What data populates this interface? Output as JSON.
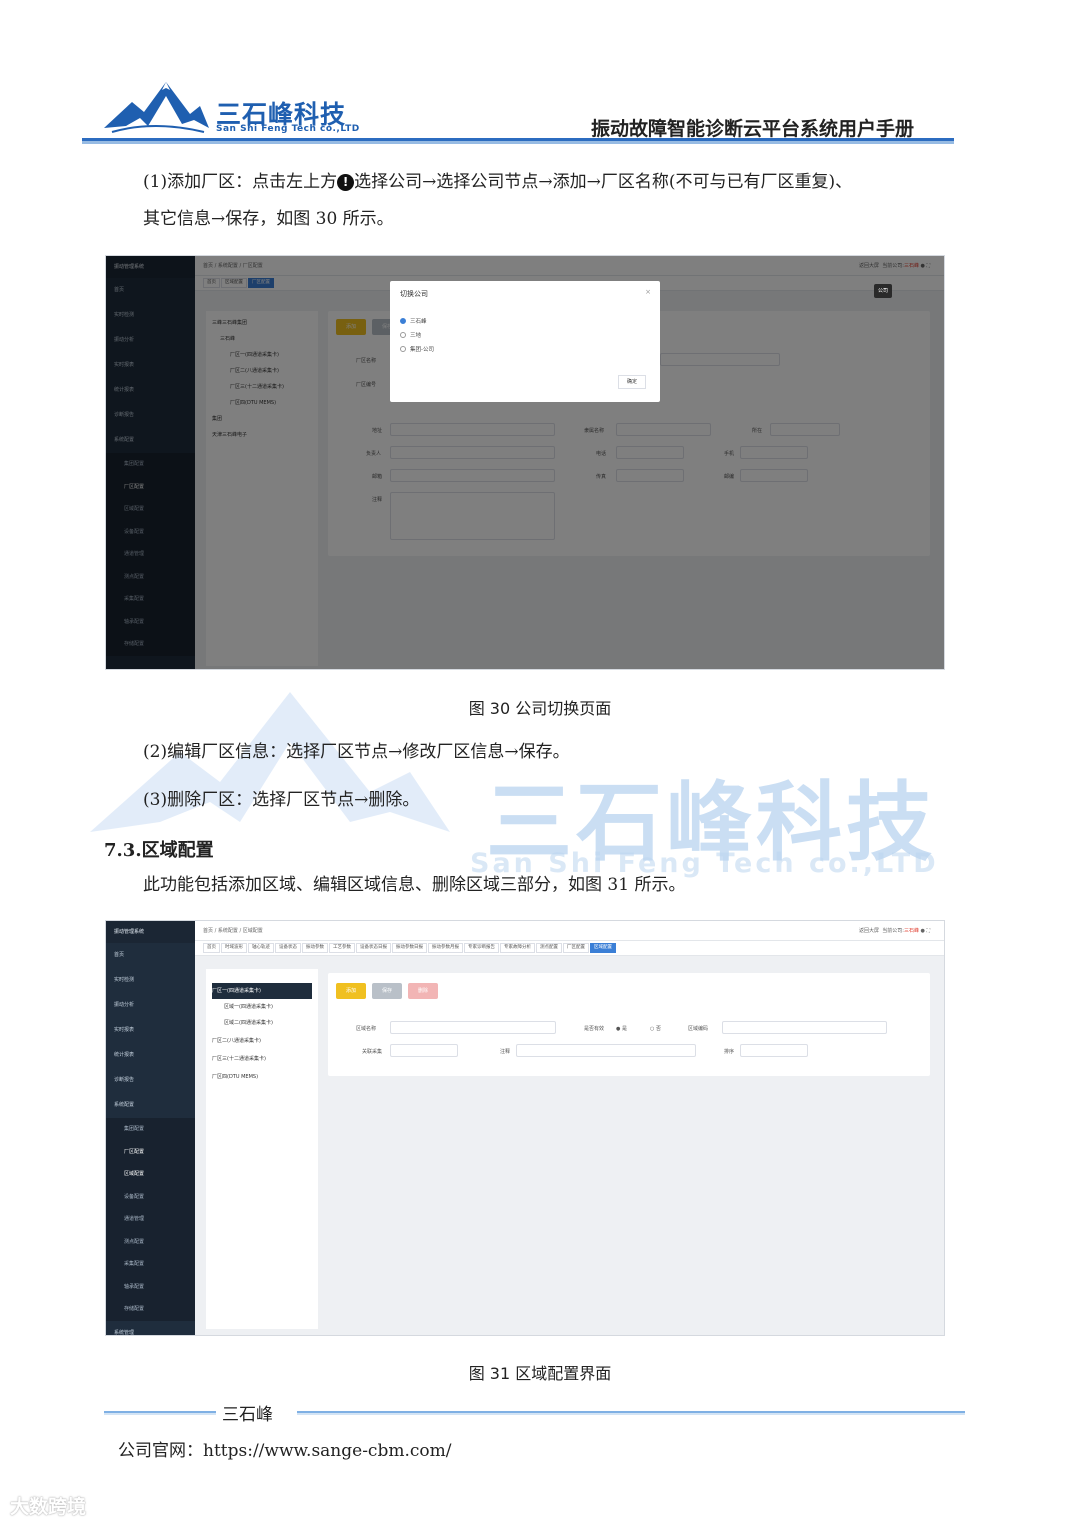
{
  "header": {
    "brand": "三石峰科技",
    "brand_en": "San Shi Feng Tech co.,LTD",
    "doc_title": "振动故障智能诊断云平台系统用户手册"
  },
  "body": {
    "p1_line1_a": "(1)添加厂区：点击左上方",
    "p1_icon": "!",
    "p1_line1_b": "选择公司→选择公司节点→添加→厂区名称(不可与已有厂区重复)、",
    "p1_line2": "其它信息→保存，如图 30 所示。",
    "fig30_caption": "图 30  公司切换页面",
    "p2": "(2)编辑厂区信息：选择厂区节点→修改厂区信息→保存。",
    "p3": "(3)删除厂区：选择厂区节点→删除。",
    "section_heading": "7.3.区域配置",
    "p4": "此功能包括添加区域、编辑区域信息、删除区域三部分，如图 31 所示。",
    "fig31_caption": "图 31  区域配置界面"
  },
  "watermark": {
    "text": "三石峰科技",
    "text_en": "San Shi Feng Tech co.,LTD"
  },
  "app": {
    "system_name": "振动管理系统",
    "menu": [
      "首页",
      "实时检测",
      "振动分析",
      "实时报表",
      "统计报表",
      "诊断报告",
      "系统配置"
    ],
    "submenu": [
      "集团配置",
      "厂区配置",
      "区域配置",
      "设备配置",
      "通道管理",
      "测点配置",
      "采集配置",
      "轴承配置",
      "存储配置"
    ],
    "bottom_menu": "系统管理",
    "top_right_label": "返回大屏",
    "current_company_label": "当前公司:",
    "current_company": "三石峰"
  },
  "fig30": {
    "breadcrumb": "首页 / 系统配置 / 厂区配置",
    "tabs": [
      "首页",
      "区域配置",
      "厂区配置"
    ],
    "tree": [
      "三石峰",
      "厂区一(四通道采集卡)",
      "厂区二(八通道采集卡)",
      "厂区三(十二通道采集卡)",
      "厂区四(DTU MEMS)",
      "集团",
      "天津三石峰电子"
    ],
    "tree_root": "三峰三石峰集团",
    "buttons": [
      "添加",
      "保存"
    ],
    "labels": [
      "厂区名称",
      "厂区编号",
      "地址",
      "负责人",
      "邮箱",
      "注释",
      "隶属名称",
      "电话",
      "传真",
      "所在",
      "手机",
      "邮编"
    ],
    "modal_title": "切换公司",
    "modal_options": [
      "三石峰",
      "三地",
      "集团-公司"
    ],
    "modal_ok": "确定",
    "corner_button": "公司"
  },
  "fig31": {
    "breadcrumb": "首页 / 系统配置 / 区域配置",
    "tabs": [
      "首页",
      "时域波形",
      "轴心轨迹",
      "设备状态",
      "振动参数",
      "工艺参数",
      "设备状态日报",
      "振动参数日报",
      "振动参数月报",
      "专家诊断报告",
      "专家故障分析",
      "测点配置",
      "厂区配置",
      "区域配置"
    ],
    "tree": [
      "厂区一(四通道采集卡)",
      "区域一(四通道采集卡)",
      "区域二(四通道采集卡)",
      "厂区二(八通道采集卡)",
      "厂区三(十二通道采集卡)",
      "厂区四(DTU MEMS)"
    ],
    "buttons": [
      "添加",
      "保存",
      "删除"
    ],
    "labels": [
      "区域名称",
      "是否有效",
      "是",
      "否",
      "区域编码",
      "关联采集",
      "注释",
      "排序"
    ]
  },
  "footer": {
    "company": "三石峰",
    "website": "公司官网：https://www.sange-cbm.com/"
  },
  "corner_mark": "大数跨境"
}
